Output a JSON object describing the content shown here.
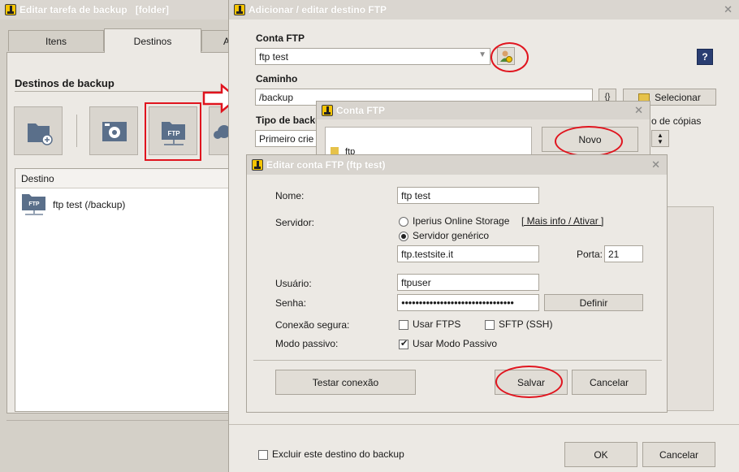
{
  "main_window": {
    "title": "Editar tarefa de backup   [folder]",
    "tabs": [
      "Itens",
      "Destinos",
      "A"
    ],
    "section_title": "Destinos de backup",
    "list_header": "Destino",
    "list_items": [
      {
        "label": "ftp test (/backup)",
        "icon": "ftp-folder-icon"
      }
    ],
    "ftp_icon_text": "FTP"
  },
  "ftp_dest_dialog": {
    "title": "Adicionar / editar destino FTP",
    "conta_label": "Conta FTP",
    "conta_value": "ftp test",
    "help_label": "?",
    "caminho_label": "Caminho",
    "caminho_value": "/backup",
    "brace_label": "{}",
    "selecionar_label": "Selecionar",
    "tipo_label": "Tipo de backu",
    "tipo_value": "Primeiro crie u",
    "copias_label": "o de cópias",
    "excluir_label": "Excluir este destino do backup",
    "excluir_checked": false,
    "ok_label": "OK",
    "cancel_label": "Cancelar"
  },
  "conta_ftp_dialog": {
    "title": "Conta FTP",
    "list_item_partial": "ftp",
    "novo_label": "Novo"
  },
  "edit_account_dialog": {
    "title": "Editar conta FTP (ftp test)",
    "nome_label": "Nome:",
    "nome_value": "ftp test",
    "servidor_label": "Servidor:",
    "radio_online": "Iperius Online Storage",
    "radio_online_selected": false,
    "mais_info": "[ Mais info / Ativar ]",
    "radio_generic": "Servidor genérico",
    "radio_generic_selected": true,
    "server_value": "ftp.testsite.it",
    "porta_label": "Porta:",
    "porta_value": "21",
    "usuario_label": "Usuário:",
    "usuario_value": "ftpuser",
    "senha_label": "Senha:",
    "senha_value": "●●●●●●●●●●●●●●●●●●●●●●●●●●●●●●●●",
    "definir_label": "Definir",
    "conexao_label": "Conexão segura:",
    "ftps_label": "Usar FTPS",
    "ftps_checked": false,
    "sftp_label": "SFTP (SSH)",
    "sftp_checked": false,
    "passivo_label": "Modo passivo:",
    "passivo_option": "Usar Modo Passivo",
    "passivo_checked": true,
    "testar_label": "Testar conexão",
    "salvar_label": "Salvar",
    "cancelar_label": "Cancelar"
  },
  "colors": {
    "window_bg": "#d4d0c8",
    "title_inactive": "#dad6d0",
    "annotation_red": "#e0141e",
    "icon_blue": "#5a6f8a"
  }
}
